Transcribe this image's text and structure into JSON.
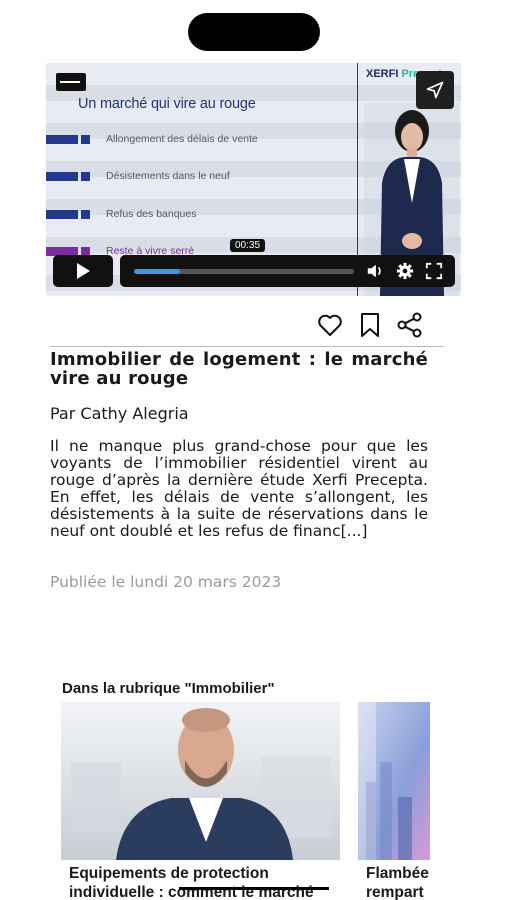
{
  "video": {
    "slide_title": "Un marché qui vire au rouge",
    "bullets": [
      "Allongement des délais de vente",
      "Désistements dans le neuf",
      "Refus des banques",
      "Reste à vivre serré"
    ],
    "brand_left": "XERFI",
    "brand_right": "Precepta",
    "current_time": "00:35",
    "progress_fraction": 0.21
  },
  "article": {
    "title": "Immobilier de logement : le marché vire au rouge",
    "author": "Par Cathy Alegria",
    "summary": "Il ne manque plus grand-chose pour que les voyants de l’immobilier résidentiel virent au rouge d’après la dernière étude Xerfi Precepta. En effet, les délais de vente s’allongent, les désistements à la suite de réservations dans le neuf ont doublé et les refus de financ[...]",
    "published": "Publiée le lundi 20 mars 2023"
  },
  "related": {
    "label": "Dans la rubrique \"Immobilier\"",
    "cards": [
      {
        "title_line1": "Equipements de protection",
        "title_line2": "individuelle : comment le marché"
      },
      {
        "title_line1": "Flambée",
        "title_line2": "rempart"
      }
    ]
  },
  "colors": {
    "accent": "#2d9bea",
    "slide_blue": "#233a8a",
    "slide_purple": "#7a2d9b"
  },
  "icons": [
    "back-icon",
    "send-icon",
    "play-icon",
    "volume-icon",
    "settings-icon",
    "fullscreen-icon",
    "heart-icon",
    "bookmark-icon",
    "share-icon"
  ]
}
